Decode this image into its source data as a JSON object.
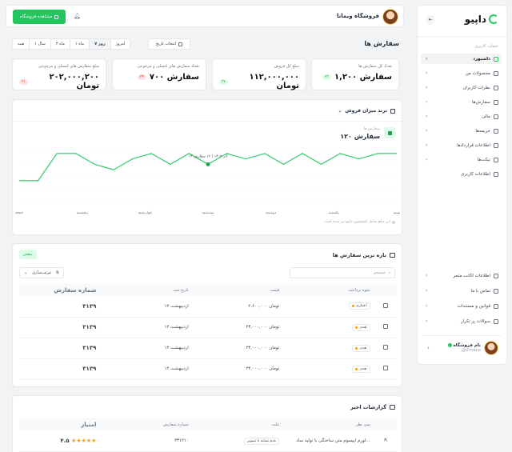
{
  "sidebar": {
    "logo_text": "داپیو",
    "collapse_icon": "collapse-icon",
    "section_label": "حساب کاربری",
    "items": [
      {
        "label": "داشبورد",
        "active": true,
        "chevron": true
      },
      {
        "label": "محصولات من",
        "active": false,
        "chevron": true
      },
      {
        "label": "نظرات کاربران",
        "active": false,
        "chevron": true
      },
      {
        "label": "سفارش‌ها",
        "active": false,
        "chevron": true
      },
      {
        "label": "مالی",
        "active": false,
        "chevron": true
      },
      {
        "label": "جریمه‌ها",
        "active": false,
        "chevron": true
      },
      {
        "label": "اطلاعات قراردادها",
        "active": false,
        "chevron": true
      },
      {
        "label": "تیکت‌ها",
        "active": false,
        "chevron": true
      },
      {
        "label": "اطلاعات کاربری",
        "active": false,
        "chevron": false
      }
    ],
    "bottom_items": [
      {
        "label": "اطلاعات اکانت متجر"
      },
      {
        "label": "تماس با ما"
      },
      {
        "label": "قوانین و مستندات"
      },
      {
        "label": "سوالات پر تکرار"
      }
    ],
    "user": {
      "name": "نام فروشگاه",
      "handle": "@Vimana"
    }
  },
  "topbar": {
    "shop_name": "فروشگاه ویمانا",
    "view_shop_label": "مشاهده فروشگاه"
  },
  "page": {
    "title": "سفارش ها",
    "date_button": "انتخاب تاریخ",
    "periods": [
      "همه",
      "۱ سال",
      "۳ ماه",
      "۱ ماه",
      "۷ روز",
      "امروز"
    ],
    "active_period": "۷ روز"
  },
  "stats": [
    {
      "label": "تعداد کل سفارش ها",
      "value": "۱,۲۰۰ سفارش",
      "badge": "۴۳",
      "badge_color": "green"
    },
    {
      "label": "مبلغ کل فروش",
      "value": "۱۱۲,۰۰۰,۰۰۰ تومان",
      "badge": "۳۷",
      "badge_color": "green"
    },
    {
      "label": "تعداد سفارش های کنسلی و مرجوعی",
      "value": "۷۰۰ سفارش",
      "badge": "۳۴",
      "badge_color": "red"
    },
    {
      "label": "مبلغ سفارش های کنسلی و مرجوعی",
      "value": "۲۰۲,۰۰۰,۲۰۰ تومان",
      "badge": "۳۱",
      "badge_color": "red"
    }
  ],
  "chart_section": {
    "title": "ترند میزان فروش",
    "series_label": "سفارش ها",
    "series_value": "۱۲۰ سفارش",
    "tooltip": "۱۴ آذر ۱۴۰۲ | ۱۲ سفارش",
    "note": "این مبلغ شامل کمیسیون داپیو نیز شده است"
  },
  "chart_data": {
    "type": "line",
    "color": "#22c55e",
    "x": [
      "جمعه",
      "",
      "پنجشنبه",
      "",
      "چهارشنبه",
      "",
      "سه‌شنبه",
      "",
      "دوشنبه",
      "",
      "یکشنبه",
      "",
      "شنبه"
    ],
    "values": [
      4,
      4,
      9,
      9,
      7,
      6,
      8,
      9,
      7,
      9,
      7,
      9,
      8,
      9,
      7,
      9,
      7,
      9,
      8,
      9,
      9
    ],
    "tick_labels": [
      "جمعه",
      "پنجشنبه",
      "چهارشنبه",
      "سه‌شنبه",
      "دوشنبه",
      "یکشنبه",
      "شنبه"
    ],
    "highlight_index": 10
  },
  "orders": {
    "title": "تازه ترین سفارش ها",
    "more_label": "بیشتر",
    "search_placeholder": "جستجو",
    "sort_label": "مرتب‌سازی",
    "columns": [
      "شماره سفارش",
      "تاریخ ثبت",
      "قیمت",
      "نحوه پرداخت"
    ],
    "rows": [
      {
        "id": "۳۱۳۹",
        "date": "۱۲ اردیبهشت",
        "price": "۲,۶۰۰,۰۰۰ تومان",
        "payment": "اعتباری"
      },
      {
        "id": "۳۱۳۹",
        "date": "۱۲ اردیبهشت",
        "price": "۲۳,۰۰۰,۰۰۰ تومان",
        "payment": "نقدی"
      },
      {
        "id": "۳۱۳۹",
        "date": "۱۲ اردیبهشت",
        "price": "۲۳,۰۰۰,۰۰۰ تومان",
        "payment": "نقدی"
      },
      {
        "id": "۳۱۳۹",
        "date": "۱۲ اردیبهشت",
        "price": "۲۳,۰۰۰,۰۰۰ تومان",
        "payment": "نقدی"
      }
    ]
  },
  "reports": {
    "title": "گزارشات اخیر",
    "columns": [
      "امتیاز",
      "شماره سفارش",
      "علت",
      "متن نظر"
    ],
    "rows": [
      {
        "rating": "۴.۵",
        "order": "۳۳۱۲۱۰",
        "reason": "عدم تشابه با تصویر",
        "text": "لورم ایپسوم متن ساختگی با تولید ساد..."
      }
    ]
  }
}
